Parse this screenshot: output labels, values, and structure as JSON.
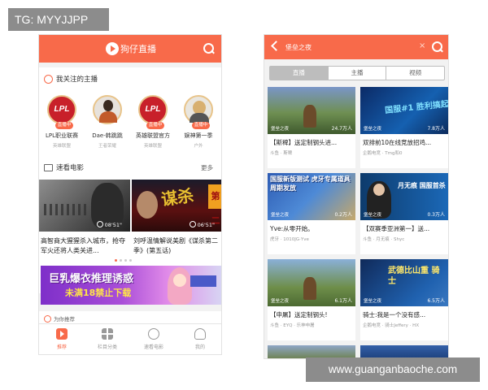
{
  "badges": {
    "top_left": "TG: MYYJJPP",
    "bottom_right": "www.guanganbaoche.com"
  },
  "left_app": {
    "header": {
      "title": "狗仔直播"
    },
    "follow": {
      "title": "我关注的主播",
      "live_label": "直播中",
      "streamers": [
        {
          "avatar_text": "LPL",
          "name": "LPL职业联赛",
          "game": "英雄联盟"
        },
        {
          "avatar_text": "",
          "name": "Dae-韩跳跳",
          "game": "王者荣耀"
        },
        {
          "avatar_text": "LPL",
          "name": "英雄联盟官方",
          "game": "英雄联盟"
        },
        {
          "avatar_text": "",
          "name": "娱神第一季",
          "game": "户外"
        }
      ]
    },
    "movies": {
      "title": "速看电影",
      "more": "更多",
      "items": [
        {
          "duration": "08'51\"",
          "title": "高智商大猩猩杀入城市，抢夺军火还将人类关进..."
        },
        {
          "poster_text": "谋杀",
          "side_text": "第二",
          "duration": "06'51\"",
          "title": "刘呼温情解说美剧《谋杀第二季》(第五话)"
        }
      ]
    },
    "banner": {
      "line1": "巨乳爆衣推理诱惑",
      "line2": "未满18禁止下载"
    },
    "recommend": {
      "title": "为你推荐"
    },
    "tabbar": [
      {
        "label": "推荐",
        "active": true
      },
      {
        "label": "栏目分类",
        "active": false
      },
      {
        "label": "速看电影",
        "active": false
      },
      {
        "label": "我的",
        "active": false
      }
    ]
  },
  "right_app": {
    "search": {
      "value": "堡垒之夜",
      "clear": "×"
    },
    "tabs": [
      {
        "label": "直播",
        "active": true
      },
      {
        "label": "主播",
        "active": false
      },
      {
        "label": "视频",
        "active": false
      }
    ],
    "cards": [
      {
        "overlay": "",
        "viewers": "24.7万人",
        "logo": "堡垒之夜",
        "title": "【斯稗】送定制钢头进...",
        "sub": "斗鱼 · 斯稗"
      },
      {
        "overlay": "国服#1 胜利搞起",
        "viewers": "7.8万人",
        "logo": "堡垒之夜",
        "title": "双排前10在线竞放招鸡...",
        "sub": "企鹅电竞 · Tmg和0"
      },
      {
        "overlay": "国服新版测试 虎牙专属道具 周期发放",
        "viewers": "0.2万人",
        "logo": "堡垒之夜",
        "title": "Yve:从零开始。",
        "sub": "虎牙 · 1010JG·Yve"
      },
      {
        "overlay": "月无痕 国服首杀",
        "viewers": "0.3万人",
        "logo": "堡垒之夜",
        "title": "【双赛季亚洲第一】送...",
        "sub": "斗鱼 · 月无痕 · Shyc"
      },
      {
        "overlay": "",
        "viewers": "6.1万人",
        "logo": "堡垒之夜",
        "title": "【申屠】送定制钢头!",
        "sub": "斗鱼 · EYQ · 乐神申屠"
      },
      {
        "overlay": "武德比山重 骑士",
        "viewers": "6.5万人",
        "logo": "堡垒之夜",
        "title": "骑士:我是一个没有感...",
        "sub": "企鹅电竞 · 骑士Jeffery · HX"
      }
    ]
  }
}
